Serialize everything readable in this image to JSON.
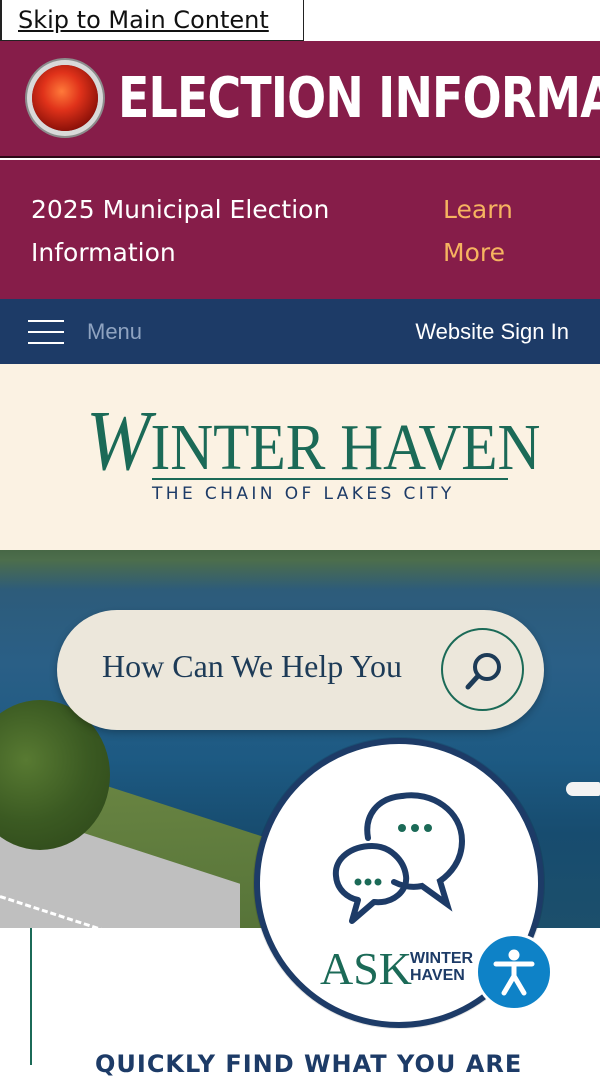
{
  "skip_link": {
    "label": "Skip to Main Content"
  },
  "election_banner": {
    "title": "ELECTION INFORMATION"
  },
  "alert": {
    "text": "2025 Municipal Election Information",
    "link_label": "Learn More"
  },
  "nav": {
    "menu_label": "Menu",
    "sign_in_label": "Website Sign In"
  },
  "logo": {
    "name_first_initial": "W",
    "name_rest": "INTER H",
    "name_tail": "AVEN",
    "tagline": "THE CHAIN OF LAKES CITY"
  },
  "search": {
    "placeholder": "How Can We Help You?"
  },
  "ask_widget": {
    "label": "ASK",
    "sub_line1": "WINTER",
    "sub_line2": "HAVEN"
  },
  "content": {
    "quick_find_heading": "QUICKLY FIND WHAT YOU ARE"
  },
  "icons": {
    "siren": "siren-icon",
    "menu": "hamburger-icon",
    "search": "search-icon",
    "chat": "chat-bubbles-icon",
    "accessibility": "accessibility-icon"
  },
  "colors": {
    "banner": "#861d49",
    "navbar": "#1d3b67",
    "logo_bg": "#fbf2e3",
    "brand_green": "#1b6a57",
    "link_orange": "#f6b460",
    "accessibility_blue": "#0e82c7"
  }
}
